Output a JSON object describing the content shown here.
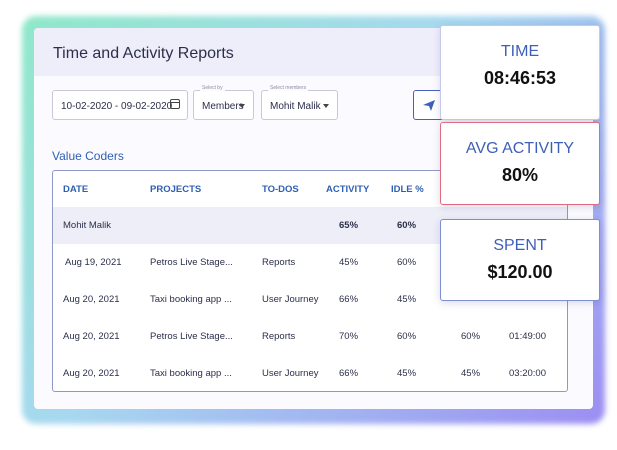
{
  "header": {
    "title": "Time and Activity Reports"
  },
  "filters": {
    "date_range": "10-02-2020 - 09-02-2020",
    "select_by_label": "Select by",
    "select_by_value": "Members",
    "members_label": "Select members",
    "members_value": "Mohit Malik"
  },
  "section_title": "Value Coders",
  "table": {
    "headers": [
      "DATE",
      "PROJECTS",
      "TO-DOS",
      "ACTIVITY",
      "IDLE %"
    ],
    "group": {
      "name": "Mohit Malik",
      "activity": "65%",
      "idle": "60%"
    },
    "rows": [
      {
        "date": "Aug 19, 2021",
        "project": "Petros Live Stage...",
        "todo": "Reports",
        "activity": "45%",
        "idle": "60%",
        "extra": "",
        "time": ""
      },
      {
        "date": "Aug 20, 2021",
        "project": "Taxi booking app ...",
        "todo": "User Journey",
        "activity": "66%",
        "idle": "45%",
        "extra": "",
        "time": ""
      },
      {
        "date": "Aug 20, 2021",
        "project": "Petros Live Stage...",
        "todo": "Reports",
        "activity": "70%",
        "idle": "60%",
        "extra": "60%",
        "time": "01:49:00"
      },
      {
        "date": "Aug 20, 2021",
        "project": "Taxi booking app ...",
        "todo": "User Journey",
        "activity": "66%",
        "idle": "45%",
        "extra": "45%",
        "time": "03:20:00"
      }
    ]
  },
  "cards": {
    "time": {
      "label": "TIME",
      "value": "08:46:53"
    },
    "avg_activity": {
      "label": "AVG ACTIVITY",
      "value": "80%"
    },
    "spent": {
      "label": "SPENT",
      "value": "$120.00"
    }
  },
  "icons": [
    "send-icon",
    "grid-icon",
    "download-icon",
    "more-icon",
    "calendar-icon"
  ],
  "colors": {
    "accent": "#2f5fb3",
    "border": "#4a5fbf",
    "card_highlight": "#e06a80"
  }
}
